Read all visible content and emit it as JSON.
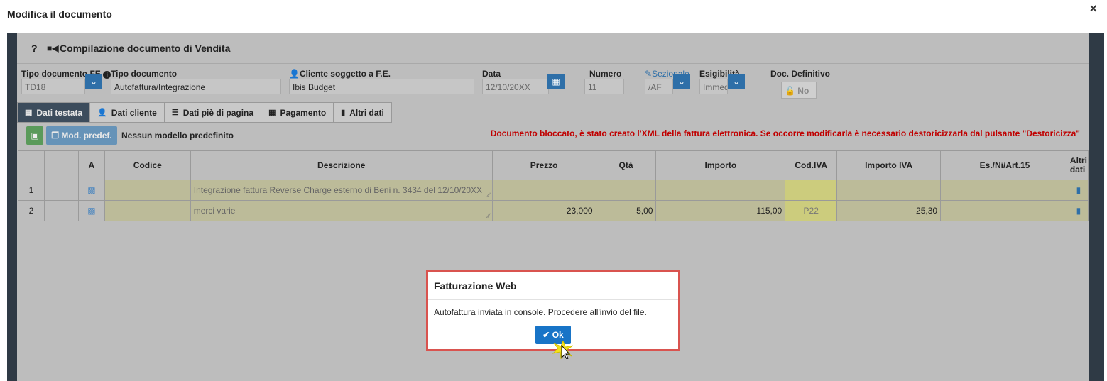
{
  "window": {
    "title": "Modifica il documento",
    "close": "×"
  },
  "panel": {
    "help": "?",
    "title": "Compilazione documento di Vendita"
  },
  "fields": {
    "tipo_fe": {
      "label": "Tipo documento FE",
      "value": "TD18"
    },
    "tipo_doc": {
      "label": "Tipo documento",
      "value": "Autofattura/Integrazione"
    },
    "cliente": {
      "label": "Cliente soggetto a F.E.",
      "value": "Ibis Budget"
    },
    "data": {
      "label": "Data",
      "value": "12/10/20XX"
    },
    "numero": {
      "label": "Numero",
      "value": "11"
    },
    "sezionale": {
      "label": "Sezionale",
      "value": "/AF"
    },
    "esigibilita": {
      "label": "Esigibilità",
      "value": "Immed"
    },
    "definitivo": {
      "label": "Doc. Definitivo",
      "value": "No"
    }
  },
  "tabs": [
    {
      "label": "Dati testata",
      "icon": "table-icon"
    },
    {
      "label": "Dati cliente",
      "icon": "user-icon"
    },
    {
      "label": "Dati piè di pagina",
      "icon": "list-icon"
    },
    {
      "label": "Pagamento",
      "icon": "calendar-icon"
    },
    {
      "label": "Altri dati",
      "icon": "file-icon"
    }
  ],
  "toolbar": {
    "mod_label": "Mod. predef.",
    "no_model": "Nessun modello predefinito",
    "lock_message": "Documento bloccato, è stato creato l'XML della fattura elettronica. Se occorre modificarla è necessario destoricizzarla dal pulsante \"Destoricizza\""
  },
  "grid": {
    "headers": [
      "",
      "",
      "A",
      "Codice",
      "Descrizione",
      "Prezzo",
      "Qtà",
      "Importo",
      "Cod.IVA",
      "Importo IVA",
      "Es./Ni/Art.15",
      "Altri dati"
    ],
    "rows": [
      {
        "n": "1",
        "codice": "",
        "descrizione": "Integrazione fattura Reverse Charge esterno di Beni n. 3434 del 12/10/20XX",
        "prezzo": "",
        "qta": "",
        "importo": "",
        "cod_iva": "",
        "importo_iva": "",
        "es": ""
      },
      {
        "n": "2",
        "codice": "",
        "descrizione": "merci varie",
        "prezzo": "23,000",
        "qta": "5,00",
        "importo": "115,00",
        "cod_iva": "P22",
        "importo_iva": "25,30",
        "es": ""
      }
    ]
  },
  "dialog": {
    "title": "Fatturazione Web",
    "message": "Autofattura inviata in console. Procedere all'invio del file.",
    "ok_label": "Ok"
  }
}
